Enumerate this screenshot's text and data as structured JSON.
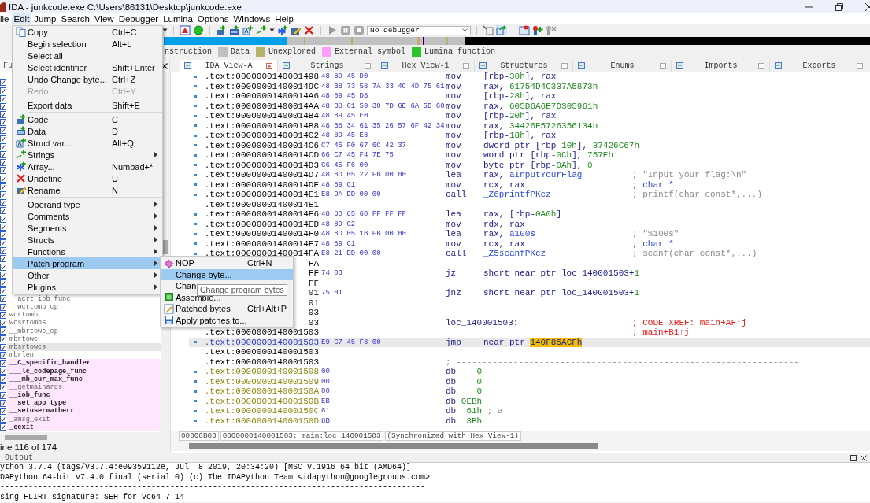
{
  "window": {
    "title": "IDA - junkcode.exe C:\\Users\\86131\\Desktop\\junkcode.exe"
  },
  "menu_bar": [
    {
      "label": "ile",
      "selected": false
    },
    {
      "label": "Edit",
      "selected": true
    },
    {
      "label": "Jump",
      "selected": false
    },
    {
      "label": "Search",
      "selected": false
    },
    {
      "label": "View",
      "selected": false
    },
    {
      "label": "Debugger",
      "selected": false
    },
    {
      "label": "Lumina",
      "selected": false
    },
    {
      "label": "Options",
      "selected": false
    },
    {
      "label": "Windows",
      "selected": false
    },
    {
      "label": "Help",
      "selected": false
    }
  ],
  "toolbar": {
    "debugger_select": "No debugger"
  },
  "legend": [
    {
      "label": "nstruction"
    },
    {
      "label": "Data",
      "color": "#c0c0c0"
    },
    {
      "label": "Unexplored",
      "color": "#b4b46e"
    },
    {
      "label": "External symbol",
      "color": "#ff9cff"
    },
    {
      "label": "Lumina function",
      "color": "#2ec42e"
    }
  ],
  "left_panel": {
    "tab": "Fu",
    "status": "ine 116 of 174",
    "functions": [
      {
        "name": "__acrt_iob_func",
        "color": "#ffffff",
        "bold": false,
        "selected": false
      },
      {
        "name": "__wcrtomb_cp",
        "color": "#ffffff",
        "bold": false,
        "selected": false
      },
      {
        "name": "wcrtomb",
        "color": "#ffffff",
        "bold": false,
        "selected": false
      },
      {
        "name": "wcsrtombs",
        "color": "#ffffff",
        "bold": false,
        "selected": false
      },
      {
        "name": "__mbrtowc_cp",
        "color": "#ffffff",
        "bold": false,
        "selected": false
      },
      {
        "name": "mbrtowc",
        "color": "#ffffff",
        "bold": false,
        "selected": false
      },
      {
        "name": "mbsrtowcs",
        "bold": false,
        "selected": true
      },
      {
        "name": "mbrlen",
        "color": "#ffffff",
        "bold": false,
        "selected": false
      },
      {
        "name": "__C_specific_handler",
        "color": "#ffe6ff",
        "bold": true,
        "selected": false
      },
      {
        "name": "___lc_codepage_func",
        "color": "#ffe6ff",
        "bold": true,
        "selected": false
      },
      {
        "name": "___mb_cur_max_func",
        "color": "#ffe6ff",
        "bold": true,
        "selected": false
      },
      {
        "name": "__getmainargs",
        "color": "#ffe6ff",
        "bold": false,
        "selected": false
      },
      {
        "name": "__iob_func",
        "color": "#ffe6ff",
        "bold": true,
        "selected": false
      },
      {
        "name": "__set_app_type",
        "color": "#ffe6ff",
        "bold": true,
        "selected": false
      },
      {
        "name": "__setusermatherr",
        "color": "#ffe6ff",
        "bold": true,
        "selected": false
      },
      {
        "name": "_amsg_exit",
        "color": "#ffe6ff",
        "bold": false,
        "selected": false
      },
      {
        "name": "_cexit",
        "color": "#ffe6ff",
        "bold": true,
        "selected": false
      }
    ]
  },
  "tabs": [
    {
      "label": "IDA View-A",
      "selected": true
    },
    {
      "label": "Strings",
      "selected": false
    },
    {
      "label": "Hex View-1",
      "selected": false
    },
    {
      "label": "Structures",
      "selected": false
    },
    {
      "label": "Enums",
      "selected": false
    },
    {
      "label": "Imports",
      "selected": false
    },
    {
      "label": "Exports",
      "selected": false
    }
  ],
  "disassembly": {
    "rows": [
      {
        "kind": "code",
        "dot": true,
        "selected": false,
        "address": ".text:0000000140001498",
        "bytes": "48 89 45 D0",
        "mnemonic": "mov",
        "operands": [
          {
            "text": "[rbp-",
            "kind": "plain"
          },
          {
            "text": "30h",
            "kind": "num"
          },
          {
            "text": "], rax",
            "kind": "plain"
          }
        ]
      },
      {
        "kind": "code",
        "dot": true,
        "selected": false,
        "address": ".text:000000014000149C",
        "bytes": "48 B8 73 58 7A 33 4C 4D 75 61",
        "mnemonic": "mov",
        "operands": [
          {
            "text": "rax, ",
            "kind": "plain"
          },
          {
            "text": "61754D4C337A5873h",
            "kind": "num"
          }
        ]
      },
      {
        "kind": "code",
        "dot": true,
        "selected": false,
        "address": ".text:00000001400014A6",
        "bytes": "48 89 45 D8",
        "mnemonic": "mov",
        "operands": [
          {
            "text": "[rbp-",
            "kind": "plain"
          },
          {
            "text": "28h",
            "kind": "num"
          },
          {
            "text": "], rax",
            "kind": "plain"
          }
        ]
      },
      {
        "kind": "code",
        "dot": true,
        "selected": false,
        "address": ".text:00000001400014AA",
        "bytes": "48 B8 61 59 30 7D 6E 6A 5D 60",
        "mnemonic": "mov",
        "operands": [
          {
            "text": "rax, ",
            "kind": "plain"
          },
          {
            "text": "605D6A6E7D305961h",
            "kind": "num"
          }
        ]
      },
      {
        "kind": "code",
        "dot": true,
        "selected": false,
        "address": ".text:00000001400014B4",
        "bytes": "48 89 45 E0",
        "mnemonic": "mov",
        "operands": [
          {
            "text": "[rbp-",
            "kind": "plain"
          },
          {
            "text": "20h",
            "kind": "num"
          },
          {
            "text": "], rax",
            "kind": "plain"
          }
        ]
      },
      {
        "kind": "code",
        "dot": true,
        "selected": false,
        "address": ".text:00000001400014B8",
        "bytes": "48 B8 34 61 35 26 57 6F 42 34",
        "mnemonic": "mov",
        "operands": [
          {
            "text": "rax, ",
            "kind": "plain"
          },
          {
            "text": "34426F5726356134h",
            "kind": "num"
          }
        ]
      },
      {
        "kind": "code",
        "dot": true,
        "selected": false,
        "address": ".text:00000001400014C2",
        "bytes": "48 89 45 E8",
        "mnemonic": "mov",
        "operands": [
          {
            "text": "[rbp-",
            "kind": "plain"
          },
          {
            "text": "18h",
            "kind": "num"
          },
          {
            "text": "], rax",
            "kind": "plain"
          }
        ]
      },
      {
        "kind": "code",
        "dot": true,
        "selected": false,
        "address": ".text:00000001400014C6",
        "bytes": "C7 45 F0 67 6C 42 37",
        "mnemonic": "mov",
        "operands": [
          {
            "text": "dword ptr [rbp-",
            "kind": "plain"
          },
          {
            "text": "10h",
            "kind": "num"
          },
          {
            "text": "], ",
            "kind": "plain"
          },
          {
            "text": "37426C67h",
            "kind": "num"
          }
        ]
      },
      {
        "kind": "code",
        "dot": true,
        "selected": false,
        "address": ".text:00000001400014CD",
        "bytes": "66 C7 45 F4 7E 75",
        "mnemonic": "mov",
        "operands": [
          {
            "text": "word ptr [rbp-",
            "kind": "plain"
          },
          {
            "text": "0Ch",
            "kind": "num"
          },
          {
            "text": "], ",
            "kind": "plain"
          },
          {
            "text": "757Eh",
            "kind": "num"
          }
        ]
      },
      {
        "kind": "code",
        "dot": true,
        "selected": false,
        "address": ".text:00000001400014D3",
        "bytes": "C6 45 F6 00",
        "mnemonic": "mov",
        "operands": [
          {
            "text": "byte ptr [rbp-",
            "kind": "plain"
          },
          {
            "text": "0Ah",
            "kind": "num"
          },
          {
            "text": "], ",
            "kind": "plain"
          },
          {
            "text": "0",
            "kind": "num"
          }
        ]
      },
      {
        "kind": "code",
        "dot": true,
        "selected": false,
        "address": ".text:00000001400014D7",
        "bytes": "48 8D 05 22 FB 00 00",
        "mnemonic": "lea",
        "operands": [
          {
            "text": "rax, ",
            "kind": "plain"
          },
          {
            "text": "aInputYourFlag",
            "kind": "sym"
          }
        ],
        "comment": {
          "text": "; \"Input your flag:\\n\"",
          "kind": "note"
        }
      },
      {
        "kind": "code",
        "dot": true,
        "selected": false,
        "address": ".text:00000001400014DE",
        "bytes": "48 89 C1",
        "mnemonic": "mov",
        "operands": [
          {
            "text": "rcx, rax",
            "kind": "plain"
          }
        ],
        "comment": {
          "text": "; char *",
          "kind": "type"
        }
      },
      {
        "kind": "code",
        "dot": true,
        "selected": false,
        "address": ".text:00000001400014E1",
        "bytes": "E8 9A DD 00 00",
        "mnemonic": "call",
        "operands": [
          {
            "text": "_Z6printfPKcz",
            "kind": "sym"
          }
        ],
        "comment": {
          "text": "; printf(char const*,...)",
          "kind": "note"
        }
      },
      {
        "kind": "line",
        "dot": false,
        "selected": false,
        "address": ".text:00000001400014E1"
      },
      {
        "kind": "code",
        "dot": true,
        "selected": false,
        "address": ".text:00000001400014E6",
        "bytes": "48 8D 85 60 FF FF FF",
        "mnemonic": "lea",
        "operands": [
          {
            "text": "rax, [rbp-",
            "kind": "plain"
          },
          {
            "text": "0A0h",
            "kind": "num"
          },
          {
            "text": "]",
            "kind": "plain"
          }
        ]
      },
      {
        "kind": "code",
        "dot": true,
        "selected": false,
        "address": ".text:00000001400014ED",
        "bytes": "48 89 C2",
        "mnemonic": "mov",
        "operands": [
          {
            "text": "rdx, rax",
            "kind": "plain"
          }
        ]
      },
      {
        "kind": "code",
        "dot": true,
        "selected": false,
        "address": ".text:00000001400014F0",
        "bytes": "48 8D 05 1B FB 00 00",
        "mnemonic": "lea",
        "operands": [
          {
            "text": "rax, ",
            "kind": "plain"
          },
          {
            "text": "a100s",
            "kind": "sym"
          }
        ],
        "comment": {
          "text": "; \"%100s\"",
          "kind": "note"
        }
      },
      {
        "kind": "code",
        "dot": true,
        "selected": false,
        "address": ".text:00000001400014F7",
        "bytes": "48 89 C1",
        "mnemonic": "mov",
        "operands": [
          {
            "text": "rcx, rax",
            "kind": "plain"
          }
        ],
        "comment": {
          "text": "; char *",
          "kind": "type"
        }
      },
      {
        "kind": "code",
        "dot": true,
        "selected": false,
        "address": ".text:00000001400014FA",
        "bytes": "E8 21 DD 00 00",
        "mnemonic": "call",
        "operands": [
          {
            "text": "_Z5scanfPKcz",
            "kind": "sym"
          }
        ],
        "comment": {
          "text": "; scanf(char const*,...)",
          "kind": "note"
        }
      },
      {
        "kind": "line",
        "dot": false,
        "selected": false,
        "address": "FA"
      },
      {
        "kind": "code",
        "dot": false,
        "selected": false,
        "address": "FF",
        "bytes": "74 03",
        "mnemonic": "jz",
        "operands": [
          {
            "text": "short near ptr loc_140001503+",
            "kind": "plain"
          },
          {
            "text": "1",
            "kind": "num"
          }
        ]
      },
      {
        "kind": "line",
        "dot": false,
        "selected": false,
        "address": "FF"
      },
      {
        "kind": "code",
        "dot": false,
        "selected": false,
        "address": "01",
        "bytes": "75 01",
        "mnemonic": "jnz",
        "operands": [
          {
            "text": "short near ptr loc_140001503+",
            "kind": "plain"
          },
          {
            "text": "1",
            "kind": "num"
          }
        ]
      },
      {
        "kind": "line",
        "dot": false,
        "selected": false,
        "address": "01"
      },
      {
        "kind": "line",
        "dot": false,
        "selected": false,
        "address": "03"
      },
      {
        "kind": "label",
        "dot": false,
        "selected": false,
        "address": "03",
        "label": "loc_140001503:",
        "comment": {
          "text": "; CODE XREF: main+AF↑j",
          "kind": "xref"
        }
      },
      {
        "kind": "line",
        "dot": false,
        "selected": false,
        "address": ".text:0000000140001503",
        "comment": {
          "text": "; main+B1↑j",
          "kind": "xref"
        }
      },
      {
        "kind": "code",
        "dot": true,
        "selected": true,
        "address": ".text:0000000140001503",
        "bytes": "E9 C7 45 F8 00",
        "mnemonic": "jmp",
        "operands": [
          {
            "text": "near ptr ",
            "kind": "plain"
          },
          {
            "text": "140F85ACFh",
            "kind": "hl"
          }
        ]
      },
      {
        "kind": "line",
        "dot": false,
        "selected": false,
        "address": ".text:0000000140001503"
      },
      {
        "kind": "separator",
        "dot": false,
        "selected": false,
        "address": ".text:0000000140001503",
        "label": "; ------------------------------------------------------------------"
      },
      {
        "kind": "data",
        "dot": true,
        "selected": false,
        "address": ".text:0000000140001508",
        "bytes": "00",
        "mnemonic": "db",
        "operands": [
          {
            "text": "0",
            "kind": "num"
          }
        ]
      },
      {
        "kind": "data",
        "dot": true,
        "selected": false,
        "address": ".text:0000000140001509",
        "bytes": "00",
        "mnemonic": "db",
        "operands": [
          {
            "text": "0",
            "kind": "num"
          }
        ]
      },
      {
        "kind": "data",
        "dot": true,
        "selected": false,
        "address": ".text:000000014000150A",
        "bytes": "00",
        "mnemonic": "db",
        "operands": [
          {
            "text": "0",
            "kind": "num"
          }
        ]
      },
      {
        "kind": "data",
        "dot": true,
        "selected": false,
        "address": ".text:000000014000150B",
        "bytes": "EB",
        "mnemonic": "db",
        "operands": [
          {
            "text": "0EBh",
            "kind": "num"
          }
        ]
      },
      {
        "kind": "data",
        "dot": true,
        "selected": false,
        "address": ".text:000000014000150C",
        "bytes": "61",
        "mnemonic": "db",
        "operands": [
          {
            "text": "61h",
            "kind": "num"
          }
        ],
        "comment": {
          "text": "; a",
          "kind": "note"
        }
      },
      {
        "kind": "data",
        "dot": true,
        "selected": false,
        "address": ".text:000000014000150D",
        "bytes": "8B",
        "mnemonic": "db",
        "operands": [
          {
            "text": "8Bh",
            "kind": "num"
          }
        ]
      }
    ],
    "status": {
      "offset": "00000B03",
      "location": "0000000140001503: main:loc_140001503",
      "sync": "(Synchronized with Hex View-1)"
    }
  },
  "output": {
    "title": "Output",
    "lines": [
      "ython 3.7.4 (tags/v3.7.4:e09359112e, Jul  8 2019, 20:34:20) [MSC v.1916 64 bit (AMD64)]",
      "DAPython 64-bit v7.4.0 final (serial 0) (c) The IDAPython Team <idapython@googlegroups.com>",
      "------------------------------------------------------------------------------------------",
      "sing FLIRT signature: SEH for vc64 7-14"
    ]
  },
  "context_menu": {
    "items": [
      {
        "kind": "copy",
        "label": "Copy",
        "shortcut": "Ctrl+C",
        "disabled": false,
        "submenu": false,
        "selected": false
      },
      {
        "kind": "plain",
        "label": "Begin selection",
        "shortcut": "Alt+L",
        "disabled": false,
        "submenu": false,
        "selected": false
      },
      {
        "kind": "plain",
        "label": "Select all",
        "disabled": false,
        "submenu": false,
        "selected": false
      },
      {
        "kind": "plain",
        "label": "Select identifier",
        "shortcut": "Shift+Enter",
        "disabled": false,
        "submenu": false,
        "selected": false
      },
      {
        "kind": "plain",
        "label": "Undo Change byte...",
        "shortcut": "Ctrl+Z",
        "disabled": false,
        "submenu": false,
        "selected": false
      },
      {
        "kind": "plain",
        "label": "Redo",
        "shortcut": "Ctrl+Y",
        "disabled": true,
        "submenu": false,
        "selected": false
      },
      {
        "kind": "separator"
      },
      {
        "kind": "plain",
        "label": "Export data",
        "shortcut": "Shift+E",
        "disabled": false,
        "submenu": false,
        "selected": false
      },
      {
        "kind": "separator"
      },
      {
        "kind": "code",
        "label": "Code",
        "shortcut": "C",
        "disabled": false,
        "submenu": false,
        "selected": false
      },
      {
        "kind": "data",
        "label": "Data",
        "shortcut": "D",
        "disabled": false,
        "submenu": false,
        "selected": false
      },
      {
        "kind": "struct",
        "label": "Struct var...",
        "shortcut": "Alt+Q",
        "disabled": false,
        "submenu": false,
        "selected": false
      },
      {
        "kind": "strings",
        "label": "Strings",
        "disabled": false,
        "submenu": true,
        "selected": false
      },
      {
        "kind": "array",
        "label": "Array...",
        "shortcut": "Numpad+*",
        "disabled": false,
        "submenu": false,
        "selected": false
      },
      {
        "kind": "undefine",
        "label": "Undefine",
        "shortcut": "U",
        "disabled": false,
        "submenu": false,
        "selected": false
      },
      {
        "kind": "rename",
        "label": "Rename",
        "shortcut": "N",
        "disabled": false,
        "submenu": false,
        "selected": false
      },
      {
        "kind": "separator"
      },
      {
        "kind": "plain",
        "label": "Operand type",
        "disabled": false,
        "submenu": true,
        "selected": false
      },
      {
        "kind": "plain",
        "label": "Comments",
        "disabled": false,
        "submenu": true,
        "selected": false
      },
      {
        "kind": "plain",
        "label": "Segments",
        "disabled": false,
        "submenu": true,
        "selected": false
      },
      {
        "kind": "plain",
        "label": "Structs",
        "disabled": false,
        "submenu": true,
        "selected": false
      },
      {
        "kind": "plain",
        "label": "Functions",
        "disabled": false,
        "submenu": true,
        "selected": false
      },
      {
        "kind": "plain",
        "label": "Patch program",
        "disabled": false,
        "submenu": true,
        "selected": true
      },
      {
        "kind": "plain",
        "label": "Other",
        "disabled": false,
        "submenu": true,
        "selected": false
      },
      {
        "kind": "plain",
        "label": "Plugins",
        "disabled": false,
        "submenu": true,
        "selected": false
      }
    ]
  },
  "submenu": {
    "items": [
      {
        "kind": "nop",
        "label": "NOP",
        "shortcut": "Ctrl+N",
        "selected": false
      },
      {
        "kind": "plain",
        "label": "Change byte...",
        "selected": true
      },
      {
        "kind": "plain",
        "label": "Chan",
        "selected": false
      },
      {
        "kind": "assemble",
        "label": "Assemble...",
        "selected": false
      },
      {
        "kind": "patched",
        "label": "Patched bytes",
        "shortcut": "Ctrl+Alt+P",
        "selected": false
      },
      {
        "kind": "apply",
        "label": "Apply patches to...",
        "selected": false
      }
    ]
  },
  "tooltip": {
    "text": "Change program bytes"
  }
}
